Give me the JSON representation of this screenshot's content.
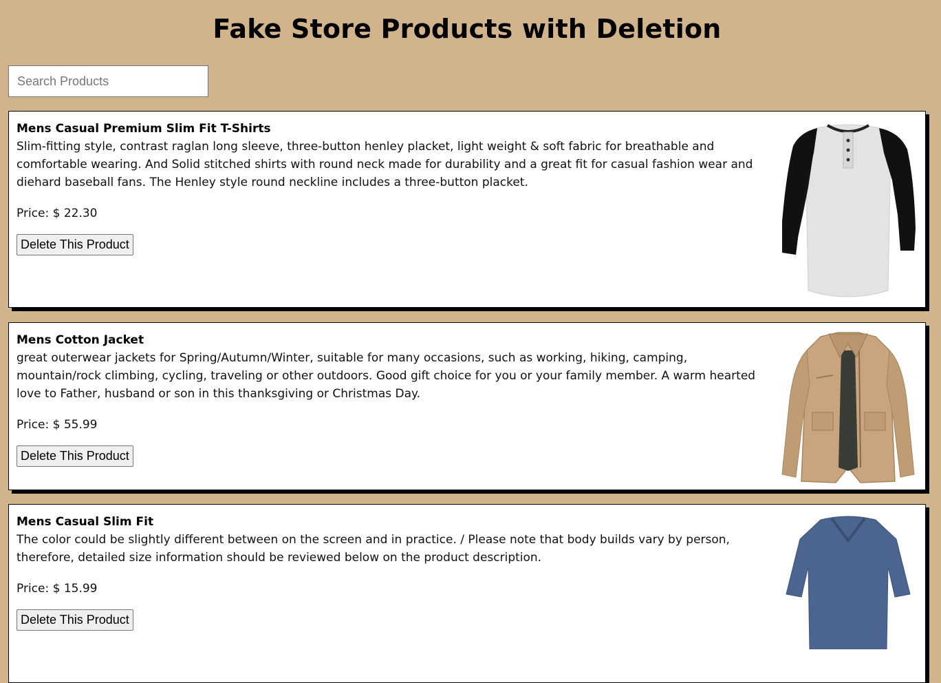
{
  "page": {
    "title": "Fake Store Products with Deletion"
  },
  "search": {
    "placeholder": "Search Products",
    "value": ""
  },
  "products": [
    {
      "title": "Mens Casual Premium Slim Fit T-Shirts",
      "description": "Slim-fitting style, contrast raglan long sleeve, three-button henley placket, light weight & soft fabric for breathable and comfortable wearing. And Solid stitched shirts with round neck made for durability and a great fit for casual fashion wear and diehard baseball fans. The Henley style round neckline includes a three-button placket.",
      "price_label": "Price: ",
      "price": "$ 22.30",
      "delete_label": "Delete This Product",
      "image_icon": "henley-tshirt-image"
    },
    {
      "title": "Mens Cotton Jacket",
      "description": "great outerwear jackets for Spring/Autumn/Winter, suitable for many occasions, such as working, hiking, camping, mountain/rock climbing, cycling, traveling or other outdoors. Good gift choice for you or your family member. A warm hearted love to Father, husband or son in this thanksgiving or Christmas Day.",
      "price_label": "Price: ",
      "price": "$ 55.99",
      "delete_label": "Delete This Product",
      "image_icon": "cotton-jacket-image"
    },
    {
      "title": "Mens Casual Slim Fit",
      "description": "The color could be slightly different between on the screen and in practice. / Please note that body builds vary by person, therefore, detailed size information should be reviewed below on the product description.",
      "price_label": "Price: ",
      "price": "$ 15.99",
      "delete_label": "Delete This Product",
      "image_icon": "blue-longsleeve-shirt-image"
    }
  ],
  "colors": {
    "background": "#d2b48c",
    "card": "#ffffff",
    "shadow": "#000000",
    "button": "#efefef"
  }
}
